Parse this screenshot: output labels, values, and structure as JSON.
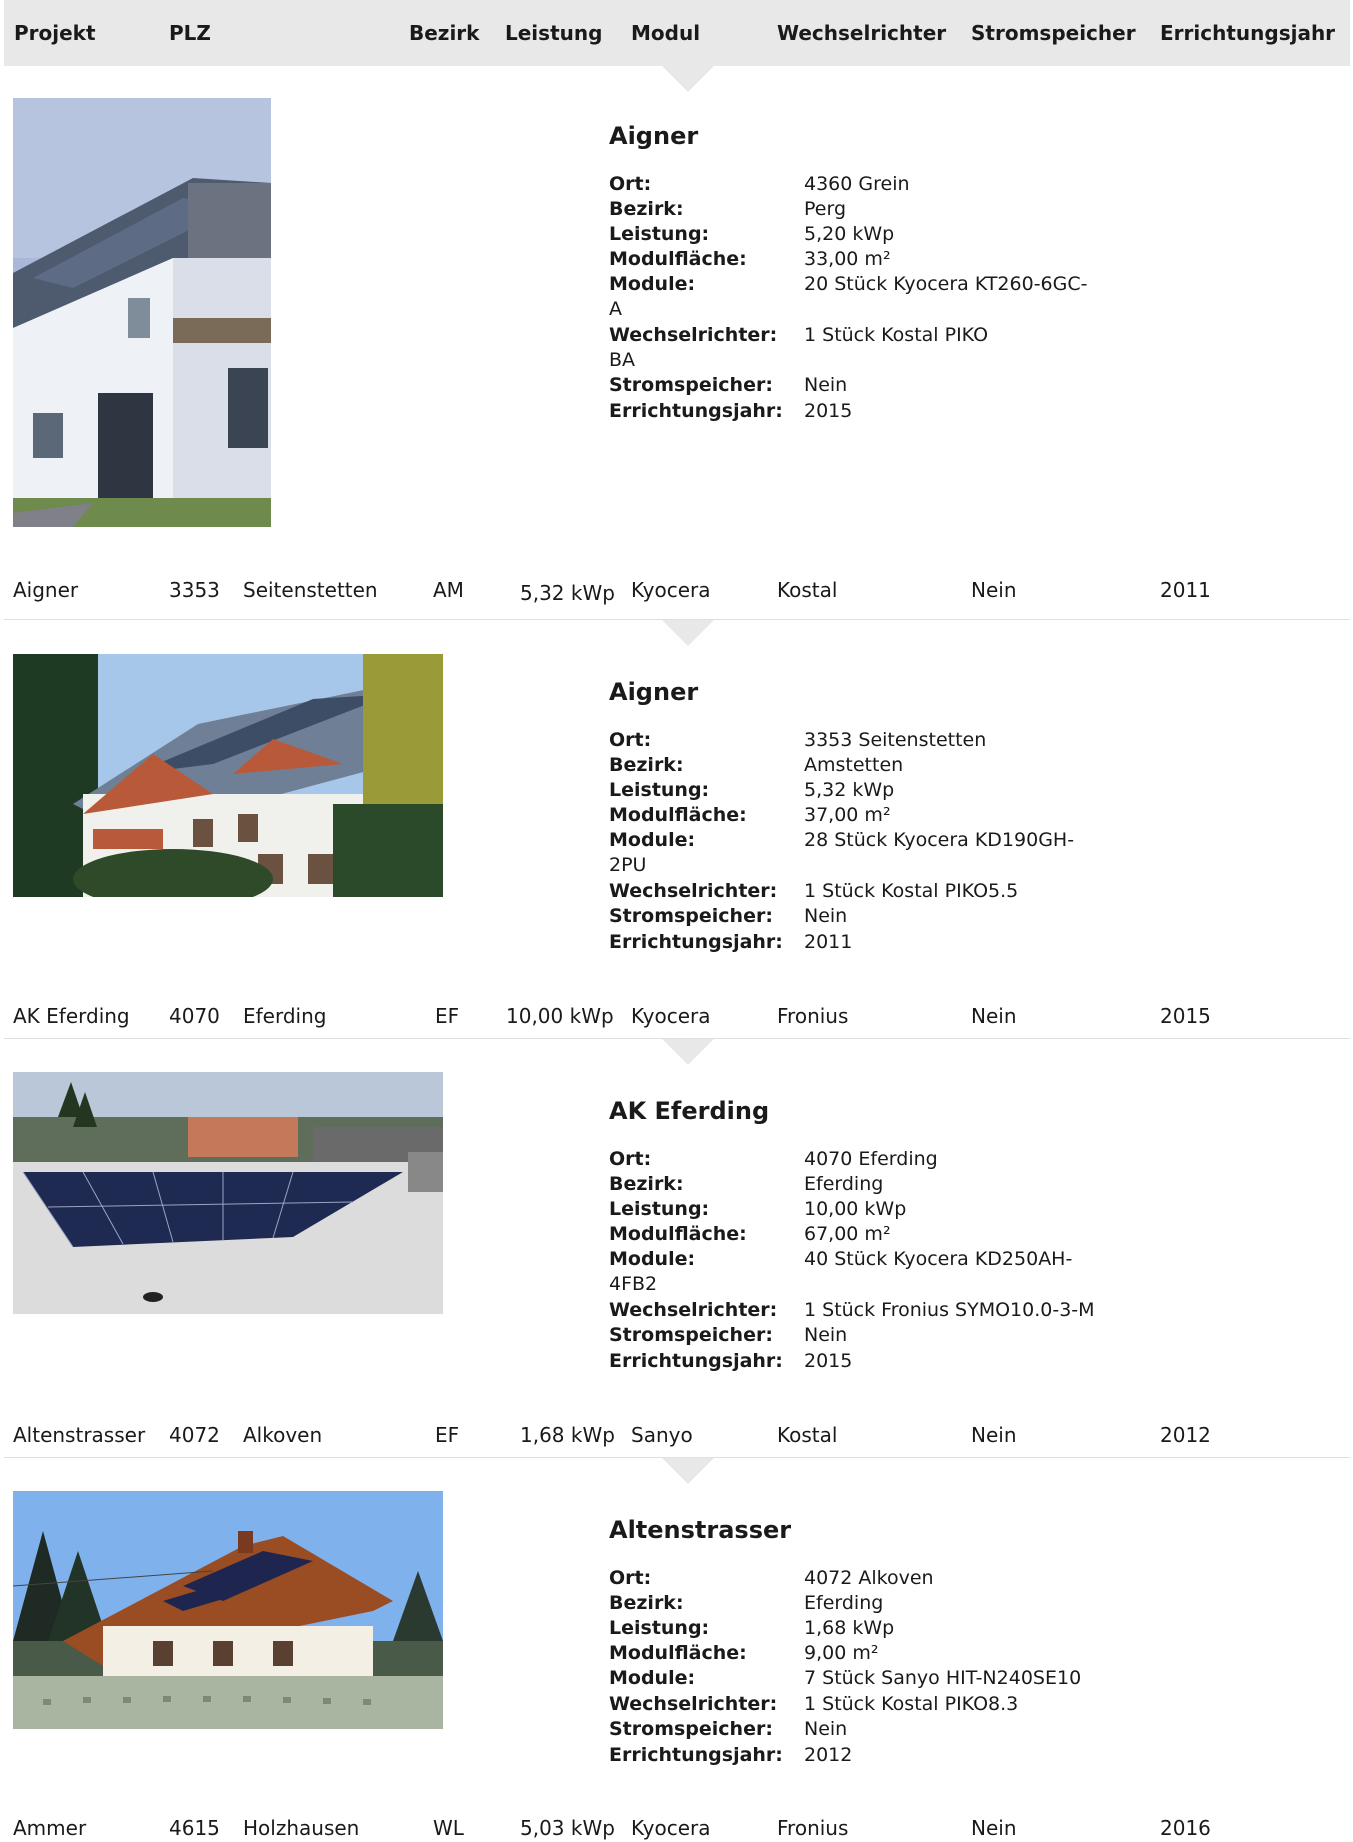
{
  "header": {
    "projekt": "Projekt",
    "plz": "PLZ",
    "bezirk": "Bezirk",
    "leistung": "Leistung",
    "modul": "Modul",
    "wechselrichter": "Wechselrichter",
    "stromspeicher": "Stromspeicher",
    "errichtungsjahr": "Errichtungsjahr"
  },
  "labels": {
    "ort": "Ort:",
    "bezirk": "Bezirk:",
    "leistung": "Leistung:",
    "modulflaeche": "Modulfläche:",
    "module": "Module:",
    "wechselrichter": "Wechselrichter:",
    "stromspeicher": "Stromspeicher:",
    "errichtungsjahr": "Errichtungsjahr:"
  },
  "details": [
    {
      "title": "Aigner",
      "ort": "4360 Grein",
      "bezirk": "Perg",
      "leistung": "5,20 kWp",
      "modulflaeche": "33,00 m²",
      "module_1": "20 Stück Kyocera KT260-6GC-",
      "module_2": "A",
      "wechselrichter_1": "1 Stück Kostal PIKO",
      "wechselrichter_2": "BA",
      "stromspeicher": "Nein",
      "errichtungsjahr": "2015"
    },
    {
      "title": "Aigner",
      "ort": "3353 Seitenstetten",
      "bezirk": "Amstetten",
      "leistung": "5,32 kWp",
      "modulflaeche": "37,00 m²",
      "module_1": "28 Stück Kyocera KD190GH-",
      "module_2": "2PU",
      "wechselrichter": "1 Stück Kostal PIKO5.5",
      "stromspeicher": "Nein",
      "errichtungsjahr": "2011"
    },
    {
      "title": "AK Eferding",
      "ort": "4070 Eferding",
      "bezirk": "Eferding",
      "leistung": "10,00 kWp",
      "modulflaeche": "67,00 m²",
      "module_1": "40 Stück Kyocera KD250AH-",
      "module_2": "4FB2",
      "wechselrichter": "1 Stück Fronius SYMO10.0-3-M",
      "stromspeicher": "Nein",
      "errichtungsjahr": "2015"
    },
    {
      "title": "Altenstrasser",
      "ort": "4072 Alkoven",
      "bezirk": "Eferding",
      "leistung": "1,68 kWp",
      "modulflaeche": "9,00 m²",
      "module": "7 Stück Sanyo HIT-N240SE10",
      "wechselrichter": "1 Stück Kostal PIKO8.3",
      "stromspeicher": "Nein",
      "errichtungsjahr": "2012"
    }
  ],
  "rows": [
    {
      "projekt": "Aigner",
      "plz": "3353",
      "ort": "Seitenstetten",
      "bezirk": "AM",
      "leistung": "5,32 kWp",
      "modul": "Kyocera",
      "wechselrichter": "Kostal",
      "stromspeicher": "Nein",
      "errichtungsjahr": "2011"
    },
    {
      "projekt": "AK Eferding",
      "plz": "4070",
      "ort": "Eferding",
      "bezirk": "EF",
      "leistung": "10,00 kWp",
      "modul": "Kyocera",
      "wechselrichter": "Fronius",
      "stromspeicher": "Nein",
      "errichtungsjahr": "2015"
    },
    {
      "projekt": "Altenstrasser",
      "plz": "4072",
      "ort": "Alkoven",
      "bezirk": "EF",
      "leistung": "1,68 kWp",
      "modul": "Sanyo",
      "wechselrichter": "Kostal",
      "stromspeicher": "Nein",
      "errichtungsjahr": "2012"
    },
    {
      "projekt": "Ammer",
      "plz": "4615",
      "ort": "Holzhausen",
      "bezirk": "WL",
      "leistung": "5,03 kWp",
      "modul": "Kyocera",
      "wechselrichter": "Fronius",
      "stromspeicher": "Nein",
      "errichtungsjahr": "2016"
    }
  ]
}
